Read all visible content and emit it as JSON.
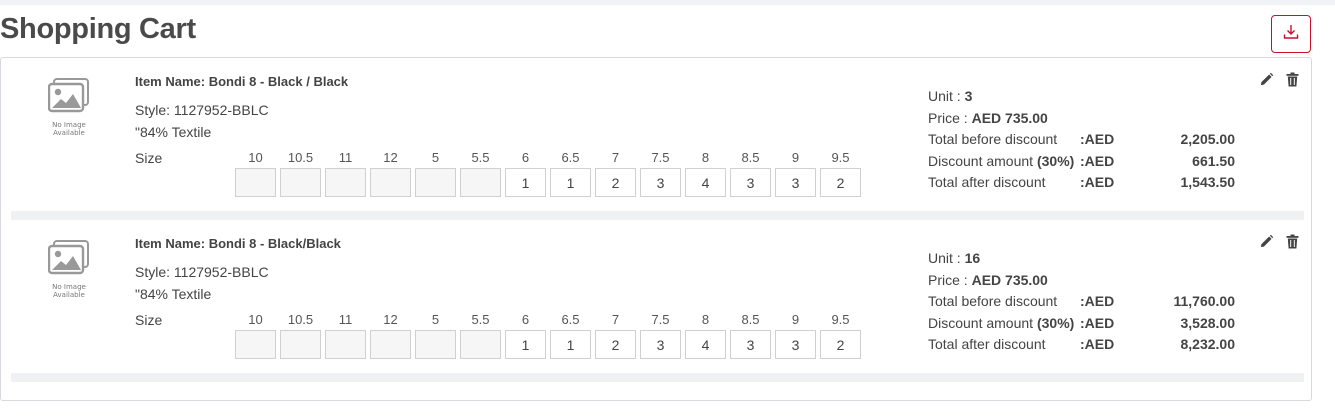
{
  "page": {
    "title": "Shopping Cart",
    "download_icon": "download-icon",
    "accent_color": "#c8102e"
  },
  "labels": {
    "item_name": "Item Name: ",
    "style": "Style: ",
    "size": "Size",
    "unit": "Unit : ",
    "price": "Price : ",
    "total_before": "Total before discount",
    "discount_amount": "Discount amount ",
    "total_after": "Total after discount",
    "currency": ":AED",
    "no_image_line1": "No Image",
    "no_image_line2": "Available"
  },
  "items": [
    {
      "name": "Bondi 8 - Black / Black",
      "style": "1127952-BBLC",
      "material": "\"84% Textile",
      "sizes": [
        "10",
        "10.5",
        "11",
        "12",
        "5",
        "5.5",
        "6",
        "6.5",
        "7",
        "7.5",
        "8",
        "8.5",
        "9",
        "9.5"
      ],
      "quantities": [
        "",
        "",
        "",
        "",
        "",
        "",
        "1",
        "1",
        "2",
        "3",
        "4",
        "3",
        "3",
        "2"
      ],
      "unit": "3",
      "price": "AED 735.00",
      "discount_percent": "(30%)",
      "total_before": "2,205.00",
      "discount": "661.50",
      "total_after": "1,543.50"
    },
    {
      "name": "Bondi 8 - Black/Black",
      "style": "1127952-BBLC",
      "material": "\"84% Textile",
      "sizes": [
        "10",
        "10.5",
        "11",
        "12",
        "5",
        "5.5",
        "6",
        "6.5",
        "7",
        "7.5",
        "8",
        "8.5",
        "9",
        "9.5"
      ],
      "quantities": [
        "",
        "",
        "",
        "",
        "",
        "",
        "1",
        "1",
        "2",
        "3",
        "4",
        "3",
        "3",
        "2"
      ],
      "unit": "16",
      "price": "AED 735.00",
      "discount_percent": "(30%)",
      "total_before": "11,760.00",
      "discount": "3,528.00",
      "total_after": "8,232.00"
    }
  ]
}
